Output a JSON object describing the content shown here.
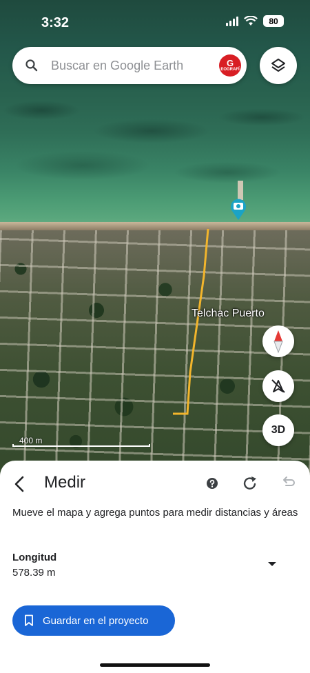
{
  "status_bar": {
    "time": "3:32",
    "battery": "80"
  },
  "search": {
    "placeholder": "Buscar en Google Earth",
    "avatar_text": "EOGRAFÍ"
  },
  "map": {
    "place_label": "Telchac Puerto",
    "scale_label": "400 m",
    "three_d_label": "3D",
    "measure_line_color": "#f2b52c"
  },
  "sheet": {
    "title": "Medir",
    "instructions": "Mueve el mapa y agrega puntos para medir distancias y áreas",
    "metric_label": "Longitud",
    "metric_value": "578.39 m",
    "save_label": "Guardar en el proyecto",
    "accent_color": "#1a66d6"
  },
  "icons": [
    "search-icon",
    "layers-icon",
    "camera-pin-icon",
    "compass-icon",
    "tilt-off-icon",
    "back-icon",
    "help-icon",
    "refresh-icon",
    "undo-icon",
    "dropdown-icon",
    "bookmark-icon"
  ]
}
